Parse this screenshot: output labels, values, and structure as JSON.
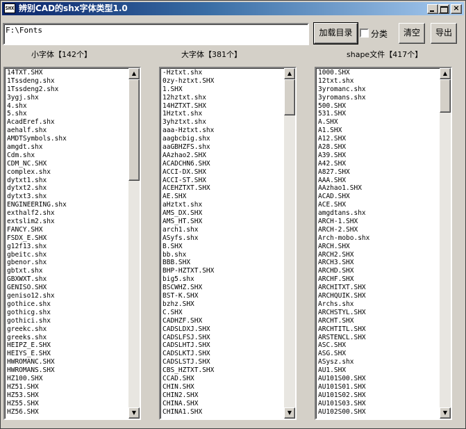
{
  "window": {
    "title": "辨别CAD的shx字体类型1.0",
    "icon_text": "SHX",
    "controls": {
      "minimize": "_",
      "maximize": "□",
      "close": "×"
    }
  },
  "toolbar": {
    "path_value": "F:\\Fonts",
    "load_label": "加载目录",
    "classify_label": "分类",
    "classify_checked": false,
    "clear_label": "清空",
    "export_label": "导出"
  },
  "small_fonts": {
    "heading": "小字体【142个】",
    "items": [
      "14TXT.SHX",
      "1Tssdeng.shx",
      "1Tssdeng2.shx",
      "3ygj.shx",
      "4.shx",
      "5.shx",
      "AcadEref.shx",
      "aehalf.shx",
      "AMDTSymbols.shx",
      "amgdt.shx",
      "Cdm.shx",
      "CDM_NC.SHX",
      "complex.shx",
      "dytxt1.shx",
      "dytxt2.shx",
      "dytxt3.shx",
      "ENGINEERING.shx",
      "exthalf2.shx",
      "extslim2.shx",
      "FANCY.SHX",
      "FSDX_E.SHX",
      "g12f13.shx",
      "gbeitc.shx",
      "gbenor.shx",
      "gbtxt.shx",
      "GBXWXT.shx",
      "GENISO.SHX",
      "geniso12.shx",
      "gothice.shx",
      "gothicg.shx",
      "gothici.shx",
      "greekc.shx",
      "greeks.shx",
      "HEIPZ_E.SHX",
      "HEIYS_E.SHX",
      "HWROMANC.SHX",
      "HWROMANS.SHX",
      "HZ100.SHX",
      "HZ51.SHX",
      "HZ53.SHX",
      "HZ55.SHX",
      "HZ56.SHX"
    ]
  },
  "big_fonts": {
    "heading": "大字体【381个】",
    "items": [
      "-Hztxt.shx",
      "0zy-hztxt.SHX",
      "1.SHX",
      "12hztxt.shx",
      "14HZTXT.SHX",
      "1Hztxt.shx",
      "3yhztxt.shx",
      "aaa-Hztxt.shx",
      "aagbcbig.shx",
      "aaGBHZFS.shx",
      "AAzhao2.SHX",
      "ACADCHN6.SHX",
      "ACCI-DX.SHX",
      "ACCI-ST.SHX",
      "ACEHZTXT.SHX",
      "AE.SHX",
      "aHztxt.shx",
      "AMS_DX.SHX",
      "AMS_HT.SHX",
      "arch1.shx",
      "ASyfs.shx",
      "B.SHX",
      "bb.shx",
      "BBB.SHX",
      "BHP-HZTXT.SHX",
      "big5.shx",
      "BSCWHZ.SHX",
      "BST-K.SHX",
      "bzhz.SHX",
      "C.SHX",
      "CADHZF.SHX",
      "CADSLDXJ.SHX",
      "CADSLFSJ.SHX",
      "CADSLHTJ.SHX",
      "CADSLKTJ.SHX",
      "CADSLSTJ.SHX",
      "CBS_HZTXT.SHX",
      "CCAD.SHX",
      "CHIN.SHX",
      "CHIN2.SHX",
      "CHINA.SHX",
      "CHINA1.SHX"
    ]
  },
  "shape_files": {
    "heading": "shape文件【417个】",
    "items": [
      "1000.SHX",
      "12txt.shx",
      "3yromanc.shx",
      "3yromans.shx",
      "500.SHX",
      "531.SHX",
      "A.SHX",
      "A1.SHX",
      "A12.SHX",
      "A28.SHX",
      "A39.SHX",
      "A42.SHX",
      "A827.SHX",
      "AAA.SHX",
      "AAzhao1.SHX",
      "ACAD.SHX",
      "ACE.SHX",
      "amgdtans.shx",
      "ARCH-1.SHX",
      "ARCH-2.SHX",
      "Arch-mobo.shx",
      "ARCH.SHX",
      "ARCH2.SHX",
      "ARCH3.SHX",
      "ARCHD.SHX",
      "ARCHF.SHX",
      "ARCHITXT.SHX",
      "ARCHQUIK.SHX",
      "Archs.shx",
      "ARCHSTYL.SHX",
      "ARCHT.SHX",
      "ARCHTITL.SHX",
      "ARSTENCL.SHX",
      "ASC.SHX",
      "ASG.SHX",
      "ASysz.shx",
      "AU1.SHX",
      "AU101S00.SHX",
      "AU101S01.SHX",
      "AU101S02.SHX",
      "AU101S03.SHX",
      "AU102S00.SHX"
    ]
  },
  "scrollbar": {
    "up_glyph": "▲",
    "down_glyph": "▼"
  }
}
